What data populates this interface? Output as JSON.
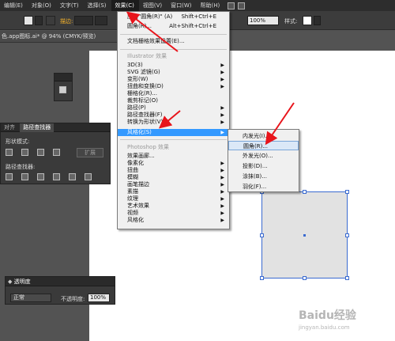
{
  "menubar": {
    "items": [
      {
        "label": "编辑(E)"
      },
      {
        "label": "对象(O)"
      },
      {
        "label": "文字(T)"
      },
      {
        "label": "选择(S)"
      },
      {
        "label": "效果(C)"
      },
      {
        "label": "视图(V)"
      },
      {
        "label": "窗口(W)"
      },
      {
        "label": "帮助(H)"
      }
    ],
    "active_index": 4
  },
  "controlbar": {
    "stroke_label": "描边:",
    "opacity_value": "100%",
    "style_label": "样式:"
  },
  "document": {
    "tab_title": "色.app图标.ai* @ 94% (CMYK/预览)"
  },
  "effect_menu": {
    "apply_label": "应用\"圆角(R)\" (A)",
    "apply_shortcut": "Shift+Ctrl+E",
    "last_label": "圆角(R)...",
    "last_shortcut": "Alt+Shift+Ctrl+E",
    "document_raster": "文档栅格效果设置(E)...",
    "illustrator_section": "Illustrator 效果",
    "illustrator_items": [
      "3D(3)",
      "SVG 滤镜(G)",
      "变形(W)",
      "扭曲和变换(D)",
      "栅格化(R)...",
      "裁剪标记(O)",
      "路径(P)",
      "路径查找器(F)",
      "转换为形状(V)",
      "风格化(S)"
    ],
    "photoshop_section": "Photoshop 效果",
    "photoshop_items": [
      "效果画廊...",
      "像素化",
      "扭曲",
      "模糊",
      "画笔描边",
      "素描",
      "纹理",
      "艺术效果",
      "视频",
      "风格化"
    ]
  },
  "stylize_submenu": {
    "items": [
      "内发光(I)...",
      "圆角(R)...",
      "外发光(O)...",
      "投影(D)...",
      "涂抹(B)...",
      "羽化(F)..."
    ],
    "highlighted_index": 1
  },
  "pathfinder_panel": {
    "tabs": [
      "对齐",
      "路径查找器"
    ],
    "shape_modes_label": "形状模式:",
    "expand_label": "扩展",
    "pathfinders_label": "路径查找器:"
  },
  "transparency_panel": {
    "title": "透明度",
    "blend_mode": "正常",
    "opacity_label": "不透明度:",
    "opacity_value": "100%"
  },
  "watermark": {
    "text": "Baidu经验",
    "subtext": "jingyan.baidu.com"
  },
  "colors": {
    "menu_highlight": "#3399ff",
    "selection_blue": "#3a6ad0",
    "annotation_arrow": "#e8141b"
  }
}
